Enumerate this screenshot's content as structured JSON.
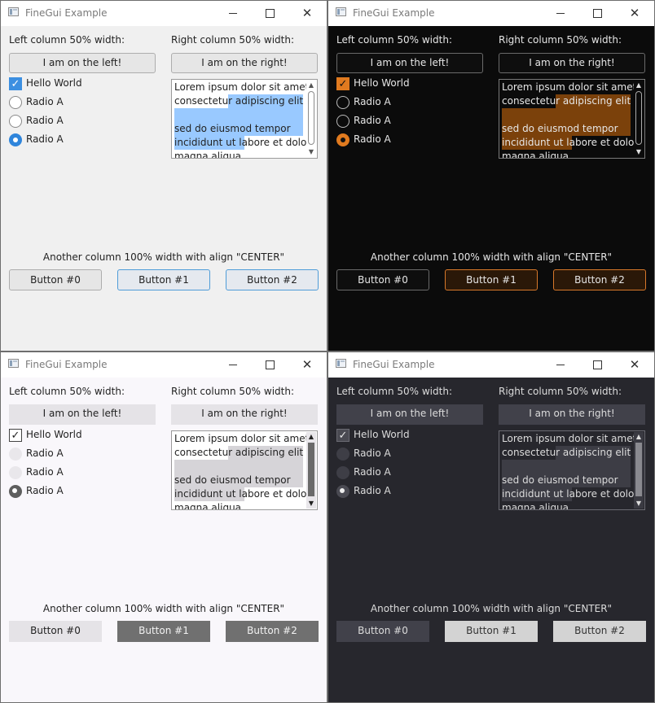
{
  "windows": [
    {
      "theme": "light",
      "title": "FineGui Example",
      "left_column_label": "Left column 50% width:",
      "right_column_label": "Right column 50% width:",
      "left_button": "I am on the left!",
      "right_button": "I am on the right!",
      "checkbox": {
        "label": "Hello World",
        "checked": true,
        "glyph": "✓"
      },
      "radios": [
        {
          "label": "Radio A",
          "selected": false
        },
        {
          "label": "Radio A",
          "selected": false
        },
        {
          "label": "Radio A",
          "selected": true
        }
      ],
      "textarea_lines": [
        "Lorem ipsum dolor sit amet,",
        "consectetur adipiscing elit",
        "",
        "sed do eiusmod tempor",
        "incididunt ut labore et dolore",
        "magna aliqua."
      ],
      "center_label": "Another column 100% width with align \"CENTER\"",
      "bottom_buttons": [
        "Button #0",
        "Button #1",
        "Button #2"
      ],
      "accent_color": "#3c8fe1"
    },
    {
      "theme": "dark-orange",
      "title": "FineGui Example",
      "left_column_label": "Left column 50% width:",
      "right_column_label": "Right column 50% width:",
      "left_button": "I am on the left!",
      "right_button": "I am on the right!",
      "checkbox": {
        "label": "Hello World",
        "checked": true,
        "glyph": "✓"
      },
      "radios": [
        {
          "label": "Radio A",
          "selected": false
        },
        {
          "label": "Radio A",
          "selected": false
        },
        {
          "label": "Radio A",
          "selected": true
        }
      ],
      "textarea_lines": [
        "Lorem ipsum dolor sit amet,",
        "consectetur adipiscing elit",
        "",
        "sed do eiusmod tempor",
        "incididunt ut labore et dolore",
        "magna aliqua."
      ],
      "center_label": "Another column 100% width with align \"CENTER\"",
      "bottom_buttons": [
        "Button #0",
        "Button #1",
        "Button #2"
      ],
      "accent_color": "#e07a1f"
    },
    {
      "theme": "flat-light",
      "title": "FineGui Example",
      "left_column_label": "Left column 50% width:",
      "right_column_label": "Right column 50% width:",
      "left_button": "I am on the left!",
      "right_button": "I am on the right!",
      "checkbox": {
        "label": "Hello World",
        "checked": true,
        "glyph": "✓"
      },
      "radios": [
        {
          "label": "Radio A",
          "selected": false
        },
        {
          "label": "Radio A",
          "selected": false
        },
        {
          "label": "Radio A",
          "selected": true
        }
      ],
      "textarea_lines": [
        "Lorem ipsum dolor sit amet,",
        "consectetur adipiscing elit",
        "",
        "sed do eiusmod tempor",
        "incididunt ut labore et dolore",
        "magna aliqua."
      ],
      "center_label": "Another column 100% width with align \"CENTER\"",
      "bottom_buttons": [
        "Button #0",
        "Button #1",
        "Button #2"
      ],
      "accent_color": "#707070"
    },
    {
      "theme": "flat-dark",
      "title": "FineGui Example",
      "left_column_label": "Left column 50% width:",
      "right_column_label": "Right column 50% width:",
      "left_button": "I am on the left!",
      "right_button": "I am on the right!",
      "checkbox": {
        "label": "Hello World",
        "checked": true,
        "glyph": "✓"
      },
      "radios": [
        {
          "label": "Radio A",
          "selected": false
        },
        {
          "label": "Radio A",
          "selected": false
        },
        {
          "label": "Radio A",
          "selected": true
        }
      ],
      "textarea_lines": [
        "Lorem ipsum dolor sit amet,",
        "consectetur adipiscing elit",
        "",
        "sed do eiusmod tempor",
        "incididunt ut labore et dolore",
        "magna aliqua."
      ],
      "center_label": "Another column 100% width with align \"CENTER\"",
      "bottom_buttons": [
        "Button #0",
        "Button #1",
        "Button #2"
      ],
      "accent_color": "#d3d3d3"
    }
  ],
  "window_controls": {
    "minimize_icon": "minimize-icon",
    "maximize_icon": "maximize-icon",
    "close_icon": "close-icon",
    "close_glyph": "✕"
  },
  "scrollbar": {
    "up_glyph": "▲",
    "down_glyph": "▼"
  }
}
